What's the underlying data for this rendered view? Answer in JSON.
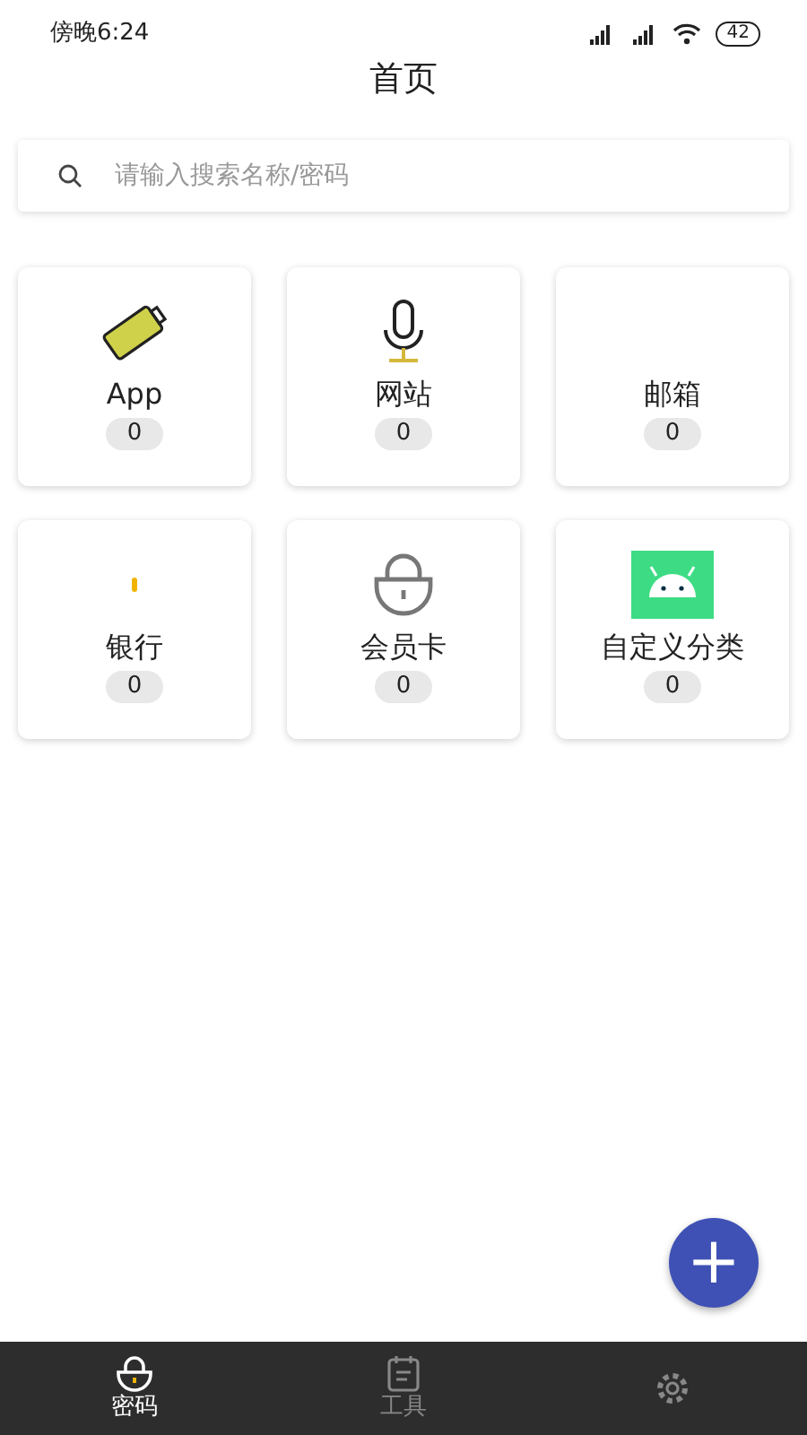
{
  "status_bar": {
    "time": "傍晚6:24",
    "battery": "42"
  },
  "title": "首页",
  "search": {
    "placeholder": "请输入搜索名称/密码"
  },
  "categories": [
    {
      "kind": "battery",
      "label": "App",
      "count": "0"
    },
    {
      "kind": "microphone",
      "label": "网站",
      "count": "0"
    },
    {
      "kind": "blank",
      "label": "邮箱",
      "count": "0"
    },
    {
      "kind": "dot",
      "label": "银行",
      "count": "0"
    },
    {
      "kind": "lock",
      "label": "会员卡",
      "count": "0"
    },
    {
      "kind": "android",
      "label": "自定义分类",
      "count": "0"
    }
  ],
  "fab": {
    "symbol": "+"
  },
  "tabs": [
    {
      "kind": "lock",
      "label": "密码",
      "selected": true
    },
    {
      "kind": "notes",
      "label": "工具",
      "selected": false
    },
    {
      "kind": "gear",
      "selected": false
    }
  ]
}
